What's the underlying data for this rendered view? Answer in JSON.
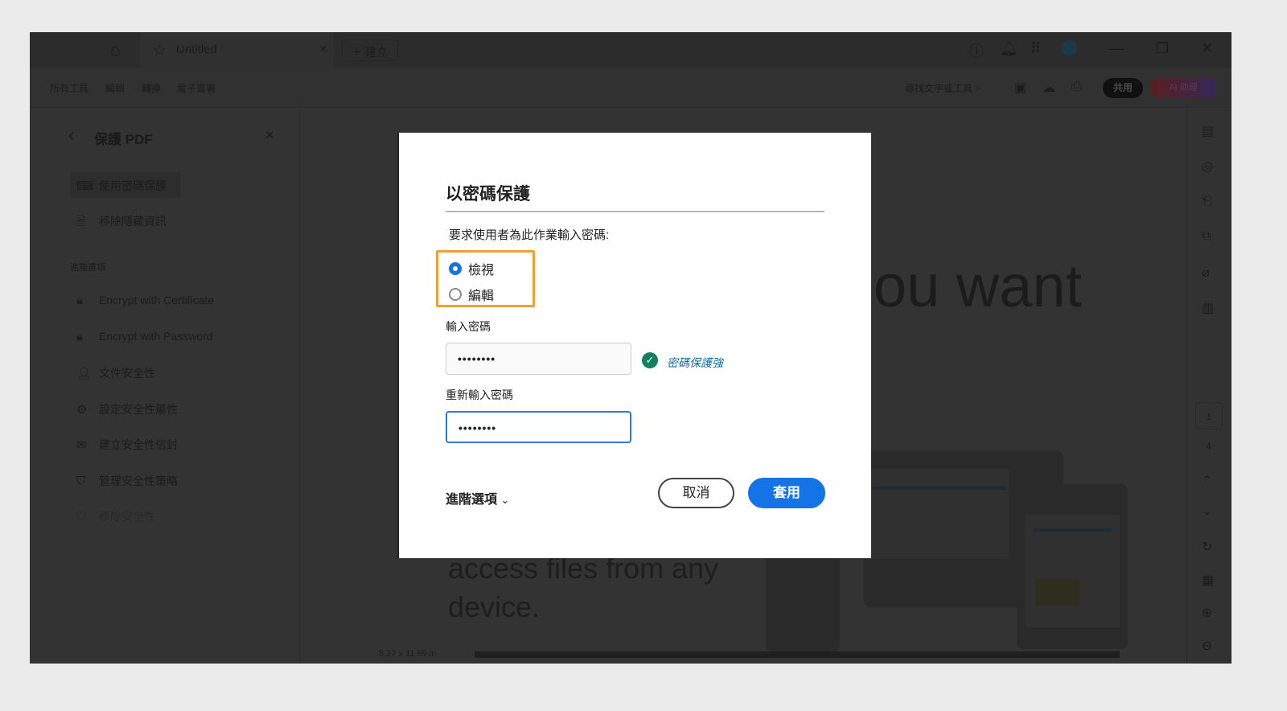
{
  "titlebar": {
    "tab_title": "Untitled",
    "new_label": "建立"
  },
  "toolbar": {
    "menus": [
      "所有工具",
      "編輯",
      "轉換",
      "電子簽署"
    ],
    "find": "尋找文字或工具",
    "share": "共用",
    "ai": "AI 助理"
  },
  "panel": {
    "title": "保護 PDF",
    "items": [
      {
        "label": "使用密碼保護",
        "icon": "password-lock-icon"
      },
      {
        "label": "移除隱藏資訊",
        "icon": "redact-doc-icon"
      }
    ],
    "section": "進階選項",
    "advanced": [
      {
        "label": "Encrypt with Certificate"
      },
      {
        "label": "Encrypt with Password"
      },
      {
        "label": "文件安全性"
      },
      {
        "label": "設定安全性屬性"
      },
      {
        "label": "建立安全性信封"
      },
      {
        "label": "管理安全性策略"
      },
      {
        "label": "移除安全性"
      }
    ]
  },
  "document": {
    "headline": "ou want",
    "body1": "access files from any",
    "body2": "device.",
    "page_size": "8.27 x 11.69 in",
    "page_current": "1",
    "page_total": "4"
  },
  "dialog": {
    "title": "以密碼保護",
    "prompt": "要求使用者為此作業輸入密碼:",
    "options": [
      {
        "label": "檢視",
        "selected": true
      },
      {
        "label": "編輯",
        "selected": false
      }
    ],
    "password_label": "輸入密碼",
    "password_value": "••••••••",
    "strength": "密碼保護強",
    "confirm_label": "重新輸入密碼",
    "confirm_value": "••••••••",
    "advanced": "進階選項",
    "cancel": "取消",
    "apply": "套用"
  },
  "colors": {
    "accent": "#1473e6",
    "highlight": "#f0a032",
    "success": "#12805c"
  }
}
